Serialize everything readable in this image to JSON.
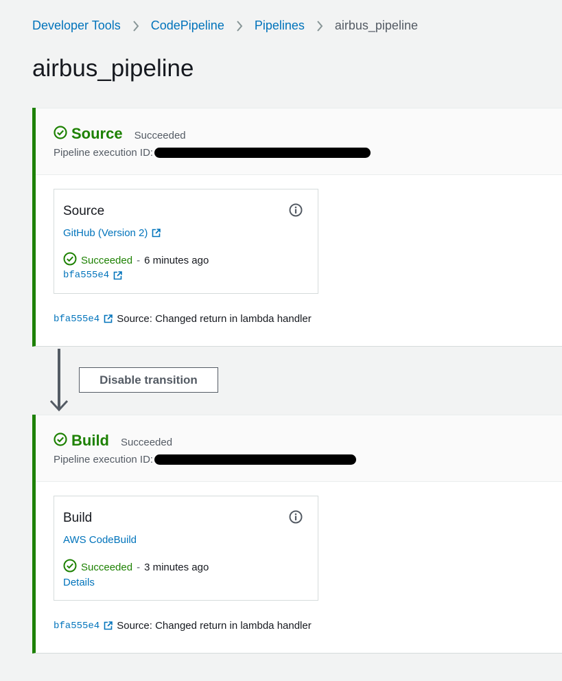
{
  "breadcrumb": {
    "items": [
      "Developer Tools",
      "CodePipeline",
      "Pipelines"
    ],
    "current": "airbus_pipeline"
  },
  "page": {
    "title": "airbus_pipeline"
  },
  "colors": {
    "success": "#1d8102",
    "link": "#0073bb",
    "stage_border": "#1d8102"
  },
  "stages": [
    {
      "name": "Source",
      "status": "Succeeded",
      "execution_label": "Pipeline execution ID:",
      "action": {
        "name": "Source",
        "provider": "GitHub (Version 2)",
        "status": "Succeeded",
        "separator": "-",
        "time": "6 minutes ago",
        "link": "bfa555e4"
      },
      "revision": {
        "id": "bfa555e4",
        "message": "Source: Changed return in lambda handler"
      }
    },
    {
      "name": "Build",
      "status": "Succeeded",
      "execution_label": "Pipeline execution ID:",
      "action": {
        "name": "Build",
        "provider": "AWS CodeBuild",
        "status": "Succeeded",
        "separator": "-",
        "time": "3 minutes ago",
        "link": "Details"
      },
      "revision": {
        "id": "bfa555e4",
        "message": "Source: Changed return in lambda handler"
      }
    }
  ],
  "transition": {
    "button_label": "Disable transition"
  },
  "icons": {
    "stage_status": "check-circle-icon",
    "info": "info-icon",
    "external": "external-link-icon",
    "separator": "chevron-right-icon",
    "transition": "arrow-down-icon"
  }
}
